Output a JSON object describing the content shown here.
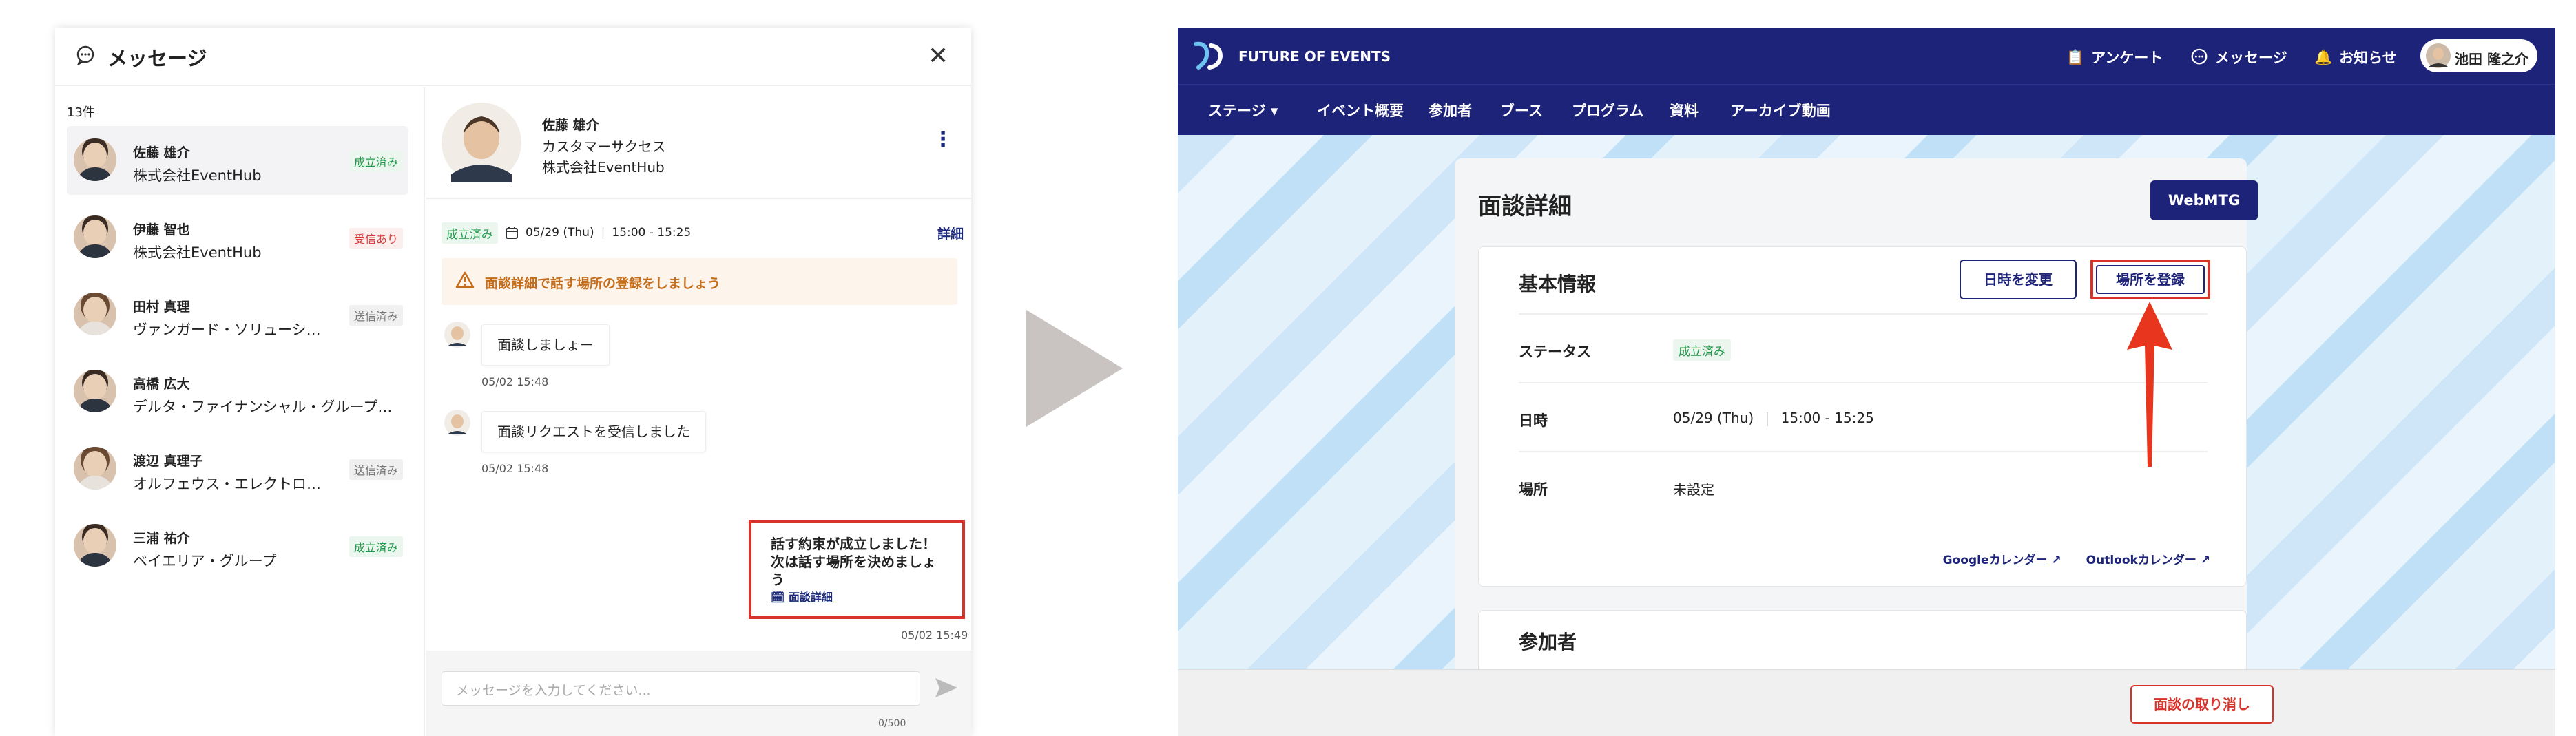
{
  "messages_panel": {
    "title": "メッセージ",
    "count": "13件",
    "conversations": [
      {
        "name": "佐藤 雄介",
        "company": "株式会社EventHub",
        "status": "成立済み",
        "status_color": "#1f9a4a"
      },
      {
        "name": "伊藤 智也",
        "company": "株式会社EventHub",
        "status": "受信あり",
        "status_color": "#d63a3a"
      },
      {
        "name": "田村 真理",
        "company": "ヴァンガード・ソリューショ…",
        "status": "送信済み",
        "status_color": "#777777"
      },
      {
        "name": "高橋 広大",
        "company": "デルタ・ファイナンシャル・グループ合…",
        "status": "",
        "status_color": ""
      },
      {
        "name": "渡辺 真理子",
        "company": "オルフェウス・エレクトロニ…",
        "status": "送信済み",
        "status_color": "#777777"
      },
      {
        "name": "三浦 祐介",
        "company": "ベイエリア・グループ",
        "status": "成立済み",
        "status_color": "#1f9a4a"
      }
    ],
    "chat": {
      "contact_name": "佐藤 雄介",
      "contact_role": "カスタマーサクセス",
      "contact_company": "株式会社EventHub",
      "status": "成立済み",
      "date": "05/29 (Thu)",
      "time": "15:00 - 15:25",
      "detail_link": "詳細",
      "warning": "面談詳細で話す場所の登録をしましょう",
      "messages": [
        {
          "text": "面談しましょー",
          "time": "05/02 15:48"
        },
        {
          "text": "面談リクエストを受信しました",
          "time": "05/02 15:48"
        }
      ],
      "my_message": {
        "line1": "話す約束が成立しました！",
        "line2": "次は話す場所を決めましょう",
        "link": "面談詳細",
        "time": "05/02 15:49"
      },
      "input_placeholder": "メッセージを入力してください...",
      "char_counter": "0/500"
    }
  },
  "app": {
    "brand": "FUTURE OF EVENTS",
    "top_nav": {
      "survey": "アンケート",
      "messages": "メッセージ",
      "notifications": "お知らせ",
      "user": "池田 隆之介"
    },
    "menu": [
      "ステージ",
      "イベント概要",
      "参加者",
      "ブース",
      "プログラム",
      "資料",
      "アーカイブ動画"
    ],
    "page_title": "面談詳細",
    "webmtg": "WebMTG",
    "basic_info": {
      "title": "基本情報",
      "change_date": "日時を変更",
      "register_place": "場所を登録",
      "status_label": "ステータス",
      "status_value": "成立済み",
      "date_label": "日時",
      "date_value": "05/29 (Thu)",
      "time_value": "15:00 - 15:25",
      "place_label": "場所",
      "place_value": "未設定",
      "google_cal": "Googleカレンダー",
      "outlook_cal": "Outlookカレンダー"
    },
    "participants_title": "参加者",
    "cancel_button": "面談の取り消し"
  },
  "colors": {
    "brand": "#1e237a",
    "highlight": "#d8332a",
    "success": "#1f9a4a"
  }
}
